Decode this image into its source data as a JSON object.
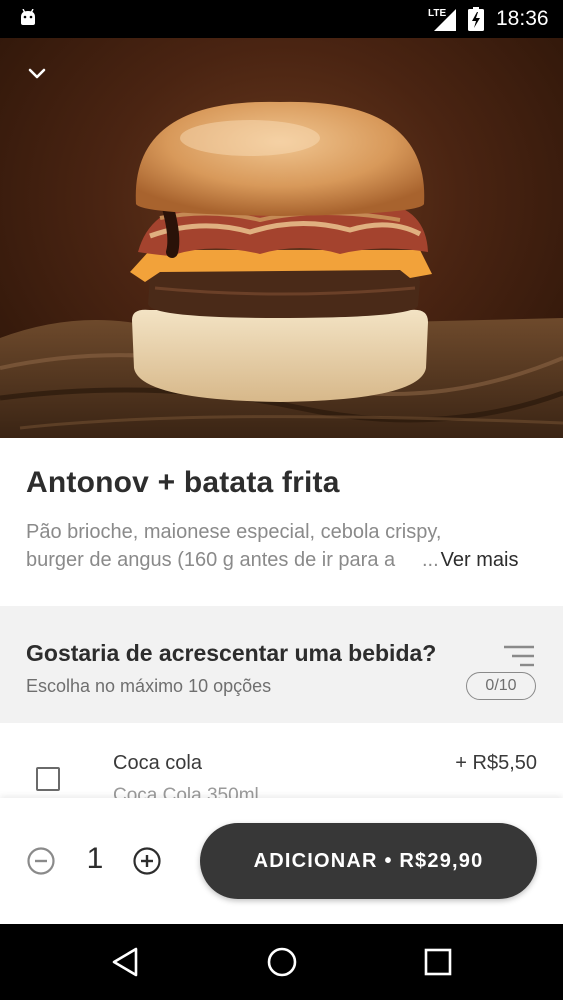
{
  "status_bar": {
    "network": "LTE",
    "time": "18:36"
  },
  "hero": {
    "collapse_icon": "chevron-down-icon"
  },
  "product": {
    "title": "Antonov + batata frita",
    "description_line1": "Pão brioche, maionese especial, cebola crispy,",
    "description_line2": "burger de angus (160 g antes de ir para a",
    "ellipsis": "...",
    "more_label": "Ver mais"
  },
  "section": {
    "title": "Gostaria de acrescentar uma bebida?",
    "subtitle": "Escolha no máximo 10 opções",
    "counter": "0/10"
  },
  "options": [
    {
      "name": "Coca cola",
      "price": "+ R$5,50",
      "description": "Coca Cola 350ml",
      "checked": false
    }
  ],
  "bottom_bar": {
    "quantity": "1",
    "add_label": "ADICIONAR • R$29,90"
  },
  "colors": {
    "button_bg": "#373737",
    "section_bg": "#f2f2f2",
    "text_primary": "#2d2d2d",
    "text_secondary": "#8a8a8a"
  }
}
